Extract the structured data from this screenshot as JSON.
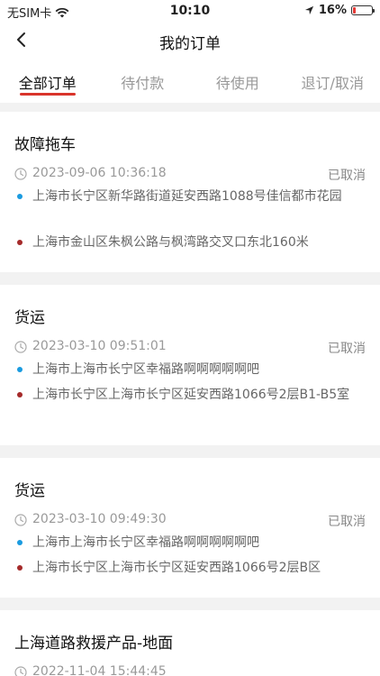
{
  "status_bar": {
    "carrier": "无SIM卡",
    "time": "10:10",
    "battery": "16%",
    "battery_level": 0.16
  },
  "nav": {
    "title": "我的订单",
    "back_icon": "chevron-left-icon"
  },
  "tabs": [
    {
      "label": "全部订单",
      "active": true
    },
    {
      "label": "待付款",
      "active": false
    },
    {
      "label": "待使用",
      "active": false
    },
    {
      "label": "退订/取消",
      "active": false
    }
  ],
  "orders": [
    {
      "title": "故障拖车",
      "time": "2023-09-06 10:36:18",
      "status": "已取消",
      "start": "上海市长宁区新华路街道延安西路1088号佳信都市花园",
      "end": "上海市金山区朱枫公路与枫湾路交叉口东北160米"
    },
    {
      "title": "货运",
      "time": "2023-03-10 09:51:01",
      "status": "已取消",
      "start": "上海市上海市长宁区幸福路啊啊啊啊啊吧",
      "end": "上海市长宁区上海市长宁区延安西路1066号2层B1-B5室"
    },
    {
      "title": "货运",
      "time": "2023-03-10 09:49:30",
      "status": "已取消",
      "start": "上海市上海市长宁区幸福路啊啊啊啊啊吧",
      "end": "上海市长宁区上海市长宁区延安西路1066号2层B区"
    },
    {
      "title": "上海道路救援产品-地面",
      "time": "2022-11-04 15:44:45",
      "status": "",
      "start": "",
      "end": ""
    }
  ],
  "colors": {
    "accent": "#d9342b",
    "start_dot": "#1a9be0",
    "end_dot": "#a52a2a"
  }
}
